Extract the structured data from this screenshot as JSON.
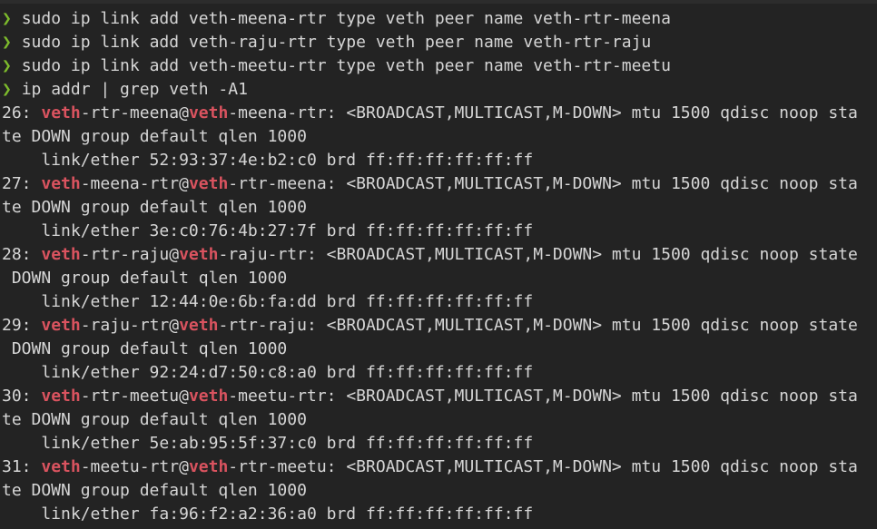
{
  "terminal": {
    "prompt_symbol": "❯",
    "highlight_term": "veth",
    "colors": {
      "background": "#232323",
      "text": "#d6d6d6",
      "prompt": "#7dbb2c",
      "highlight": "#d9535f"
    },
    "commands": [
      "sudo ip link add veth-meena-rtr type veth peer name veth-rtr-meena",
      "sudo ip link add veth-raju-rtr type veth peer name veth-rtr-raju",
      "sudo ip link add veth-meetu-rtr type veth peer name veth-rtr-meetu",
      "ip addr | grep veth -A1"
    ],
    "output": [
      {
        "index": "26: ",
        "left_rest": "-rtr-meena@",
        "right_rest": "-meena-rtr: <BROADCAST,MULTICAST,M-DOWN> mtu 1500 qdisc noop sta",
        "wrap": "te DOWN group default qlen 1000",
        "link": "    link/ether 52:93:37:4e:b2:c0 brd ff:ff:ff:ff:ff:ff"
      },
      {
        "index": "27: ",
        "left_rest": "-meena-rtr@",
        "right_rest": "-rtr-meena: <BROADCAST,MULTICAST,M-DOWN> mtu 1500 qdisc noop sta",
        "wrap": "te DOWN group default qlen 1000",
        "link": "    link/ether 3e:c0:76:4b:27:7f brd ff:ff:ff:ff:ff:ff"
      },
      {
        "index": "28: ",
        "left_rest": "-rtr-raju@",
        "right_rest": "-raju-rtr: <BROADCAST,MULTICAST,M-DOWN> mtu 1500 qdisc noop state",
        "wrap": " DOWN group default qlen 1000",
        "link": "    link/ether 12:44:0e:6b:fa:dd brd ff:ff:ff:ff:ff:ff"
      },
      {
        "index": "29: ",
        "left_rest": "-raju-rtr@",
        "right_rest": "-rtr-raju: <BROADCAST,MULTICAST,M-DOWN> mtu 1500 qdisc noop state",
        "wrap": " DOWN group default qlen 1000",
        "link": "    link/ether 92:24:d7:50:c8:a0 brd ff:ff:ff:ff:ff:ff"
      },
      {
        "index": "30: ",
        "left_rest": "-rtr-meetu@",
        "right_rest": "-meetu-rtr: <BROADCAST,MULTICAST,M-DOWN> mtu 1500 qdisc noop sta",
        "wrap": "te DOWN group default qlen 1000",
        "link": "    link/ether 5e:ab:95:5f:37:c0 brd ff:ff:ff:ff:ff:ff"
      },
      {
        "index": "31: ",
        "left_rest": "-meetu-rtr@",
        "right_rest": "-rtr-meetu: <BROADCAST,MULTICAST,M-DOWN> mtu 1500 qdisc noop sta",
        "wrap": "te DOWN group default qlen 1000",
        "link": "    link/ether fa:96:f2:a2:36:a0 brd ff:ff:ff:ff:ff:ff"
      }
    ]
  }
}
